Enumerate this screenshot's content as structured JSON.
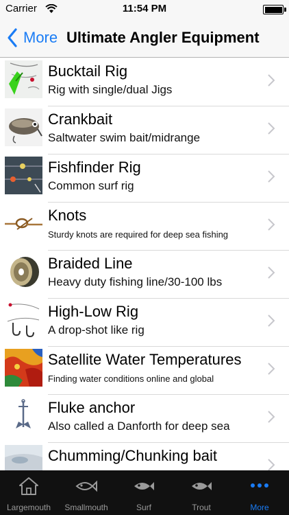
{
  "status_bar": {
    "carrier": "Carrier",
    "time": "11:54 PM",
    "wifi_icon": "wifi-icon",
    "battery_icon": "battery-icon"
  },
  "nav": {
    "back_label": "More",
    "title": "Ultimate Angler Equipment",
    "accent_color": "#1a7cf5"
  },
  "items": [
    {
      "title": "Bucktail Rig",
      "subtitle": "Rig with single/dual Jigs",
      "thumb": "bucktail-rig-thumbnail"
    },
    {
      "title": "Crankbait",
      "subtitle": "Saltwater swim bait/midrange",
      "thumb": "crankbait-thumbnail"
    },
    {
      "title": "Fishfinder Rig",
      "subtitle": "Common surf rig",
      "thumb": "fishfinder-rig-thumbnail"
    },
    {
      "title": "Knots",
      "subtitle": "Sturdy knots are required for deep sea fishing",
      "thumb": "knots-thumbnail"
    },
    {
      "title": "Braided Line",
      "subtitle": "Heavy duty fishing line/30-100 lbs",
      "thumb": "braided-line-thumbnail"
    },
    {
      "title": "High-Low Rig",
      "subtitle": "A drop-shot like rig",
      "thumb": "high-low-rig-thumbnail"
    },
    {
      "title": "Satellite Water Temperatures",
      "subtitle": "Finding water conditions online and global",
      "thumb": "satellite-map-thumbnail"
    },
    {
      "title": "Fluke anchor",
      "subtitle": "Also called a Danforth for deep sea",
      "thumb": "fluke-anchor-thumbnail"
    },
    {
      "title": "Chumming/Chunking bait",
      "subtitle": "",
      "thumb": "chum-bait-thumbnail"
    }
  ],
  "tabs": [
    {
      "label": "Largemouth",
      "icon": "house-icon"
    },
    {
      "label": "Smallmouth",
      "icon": "fish-icon"
    },
    {
      "label": "Surf",
      "icon": "fish-icon"
    },
    {
      "label": "Trout",
      "icon": "fish-icon"
    },
    {
      "label": "More",
      "icon": "more-dots-icon",
      "active": true
    }
  ]
}
